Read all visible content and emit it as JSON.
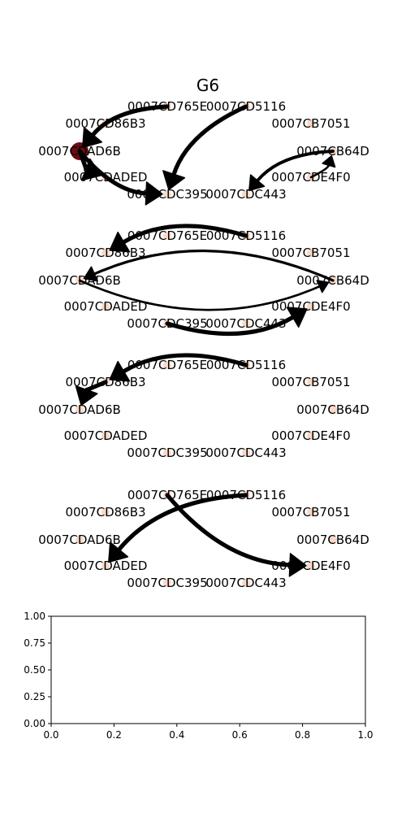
{
  "title": "G6",
  "nodes": [
    "0007CD765E",
    "0007CD5116",
    "0007CD86B3",
    "0007CB7051",
    "0007CDAD6B",
    "0007CB64D",
    "0007CDADED",
    "0007CDE4F0",
    "0007CDC395",
    "0007CDC443"
  ],
  "colors": {
    "node_default": "#fbd9c8",
    "node_hot": "#6b0a14",
    "edge": "#000000"
  },
  "panels": [
    {
      "hot_node": "0007CDAD6B",
      "edges": [
        {
          "from": "0007CD765E",
          "to": "0007CDAD6B",
          "weight": 3
        },
        {
          "from": "0007CDAD6B",
          "to": "0007CDADED",
          "weight": 3
        },
        {
          "from": "0007CDAD6B",
          "to": "0007CDC395",
          "weight": 3
        },
        {
          "from": "0007CD5116",
          "to": "0007CDC395",
          "weight": 3
        },
        {
          "from": "0007CB64D",
          "to": "0007CDC443",
          "weight": 2
        },
        {
          "from": "0007CDE4F0",
          "to": "0007CB64D",
          "weight": 1
        }
      ]
    },
    {
      "hot_node": "",
      "edges": [
        {
          "from": "0007CD5116",
          "to": "0007CD86B3",
          "weight": 3
        },
        {
          "from": "0007CB64D",
          "to": "0007CDAD6B",
          "weight": 1.5
        },
        {
          "from": "0007CDAD6B",
          "to": "0007CB64D",
          "weight": 1
        },
        {
          "from": "0007CDC395",
          "to": "0007CDE4F0",
          "weight": 3
        }
      ]
    },
    {
      "hot_node": "",
      "edges": [
        {
          "from": "0007CD5116",
          "to": "0007CD86B3",
          "weight": 3
        },
        {
          "from": "0007CD86B3",
          "to": "0007CDAD6B",
          "weight": 3
        }
      ]
    },
    {
      "hot_node": "",
      "edges": [
        {
          "from": "0007CD765E",
          "to": "0007CDE4F0",
          "weight": 3
        },
        {
          "from": "0007CD5116",
          "to": "0007CDADED",
          "weight": 3
        }
      ]
    }
  ],
  "empty_axes": {
    "x_ticks": [
      "0.0",
      "0.2",
      "0.4",
      "0.6",
      "0.8",
      "1.0"
    ],
    "y_ticks": [
      "0.00",
      "0.25",
      "0.50",
      "0.75",
      "1.00"
    ]
  }
}
